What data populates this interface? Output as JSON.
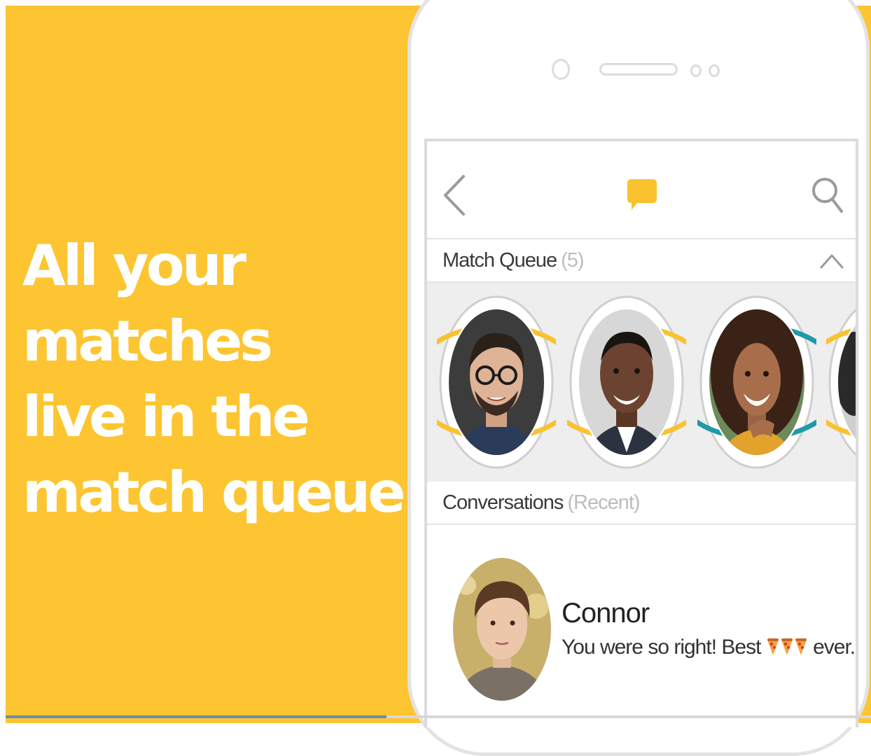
{
  "colors": {
    "background": "#FCC531",
    "accent": "#F9C22E",
    "teal": "#1E9AA8",
    "headline": "#FFFFFF"
  },
  "headline": {
    "lines": [
      "All your",
      "matches",
      "live in the",
      "match queue."
    ]
  },
  "toolbar": {
    "back_icon": "chevron-left-icon",
    "center_icon": "chat-bubble-icon",
    "search_icon": "search-icon"
  },
  "match_queue": {
    "title": "Match Queue",
    "count": "(5)",
    "collapse_icon": "chevron-up-icon",
    "avatars": [
      {
        "ring": "yellow",
        "ring_fraction": 1.0
      },
      {
        "ring": "yellow",
        "ring_fraction": 0.85
      },
      {
        "ring": "teal",
        "ring_fraction": 0.8
      },
      {
        "ring": "yellow",
        "ring_fraction": 1.0
      }
    ]
  },
  "conversations": {
    "title": "Conversations",
    "subtitle": "(Recent)",
    "items": [
      {
        "name": "Connor",
        "message_before": "You were so right! Best",
        "message_after": "ever...",
        "emoji_icon": "pizza-icon",
        "emoji_count": 3
      }
    ]
  },
  "video_progress": {
    "fraction": 0.44
  }
}
